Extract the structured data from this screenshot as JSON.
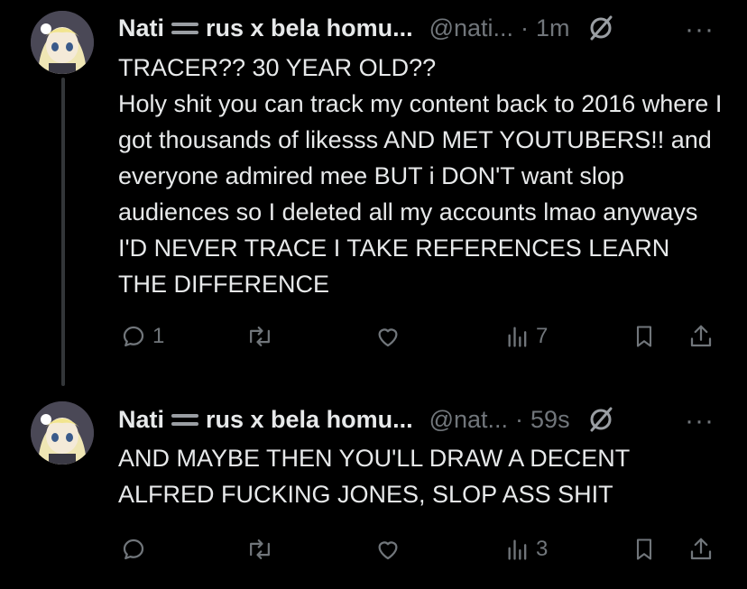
{
  "posts": [
    {
      "display_name": "Nati",
      "name_suffix": "rus x bela homu...",
      "handle": "@nati...",
      "time": "1m",
      "text": "TRACER?? 30 YEAR OLD??\nHoly shit you can track my content back to 2016 where I got thousands of likesss AND MET YOUTUBERS!! and everyone admired mee BUT i DON'T want slop audiences so I deleted all my accounts lmao anyways I'D NEVER TRACE I TAKE REFERENCES LEARN THE DIFFERENCE",
      "replies": "1",
      "reposts": "",
      "likes": "",
      "views": "7"
    },
    {
      "display_name": "Nati",
      "name_suffix": "rus x bela homu...",
      "handle": "@nat...",
      "time": "59s",
      "text": "AND MAYBE THEN YOU'LL DRAW A DECENT ALFRED FUCKING JONES, SLOP ASS SHIT",
      "replies": "",
      "reposts": "",
      "likes": "",
      "views": "3"
    }
  ],
  "separator_dot": "·",
  "more_label": "···",
  "colors": {
    "background": "#000000",
    "text": "#e7e9ea",
    "muted": "#71767b"
  },
  "icons": [
    "avatar-image",
    "flag-icon",
    "grok-icon",
    "more-icon",
    "reply-icon",
    "repost-icon",
    "like-icon",
    "views-icon",
    "bookmark-icon",
    "share-icon"
  ]
}
